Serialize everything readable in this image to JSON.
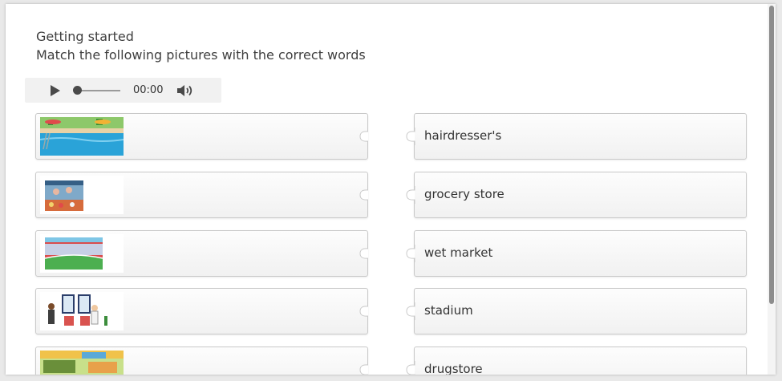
{
  "header": {
    "title_line1": "Getting started",
    "title_line2": "Match the following pictures with the correct words"
  },
  "audio_player": {
    "time": "00:00",
    "progress": 0,
    "icons": [
      "play-icon",
      "volume-icon"
    ]
  },
  "pictures": [
    {
      "scene": "swimming-pool"
    },
    {
      "scene": "wet-market-stall"
    },
    {
      "scene": "stadium"
    },
    {
      "scene": "hairdresser"
    },
    {
      "scene": "grocery-store"
    }
  ],
  "words": [
    {
      "label": "hairdresser's"
    },
    {
      "label": "grocery store"
    },
    {
      "label": "wet market"
    },
    {
      "label": "stadium"
    },
    {
      "label": "drugstore"
    }
  ],
  "colors": {
    "tile_border": "#c9c9c9",
    "scrollbar_thumb": "#8c8c8c",
    "background": "#e9e9e9"
  }
}
